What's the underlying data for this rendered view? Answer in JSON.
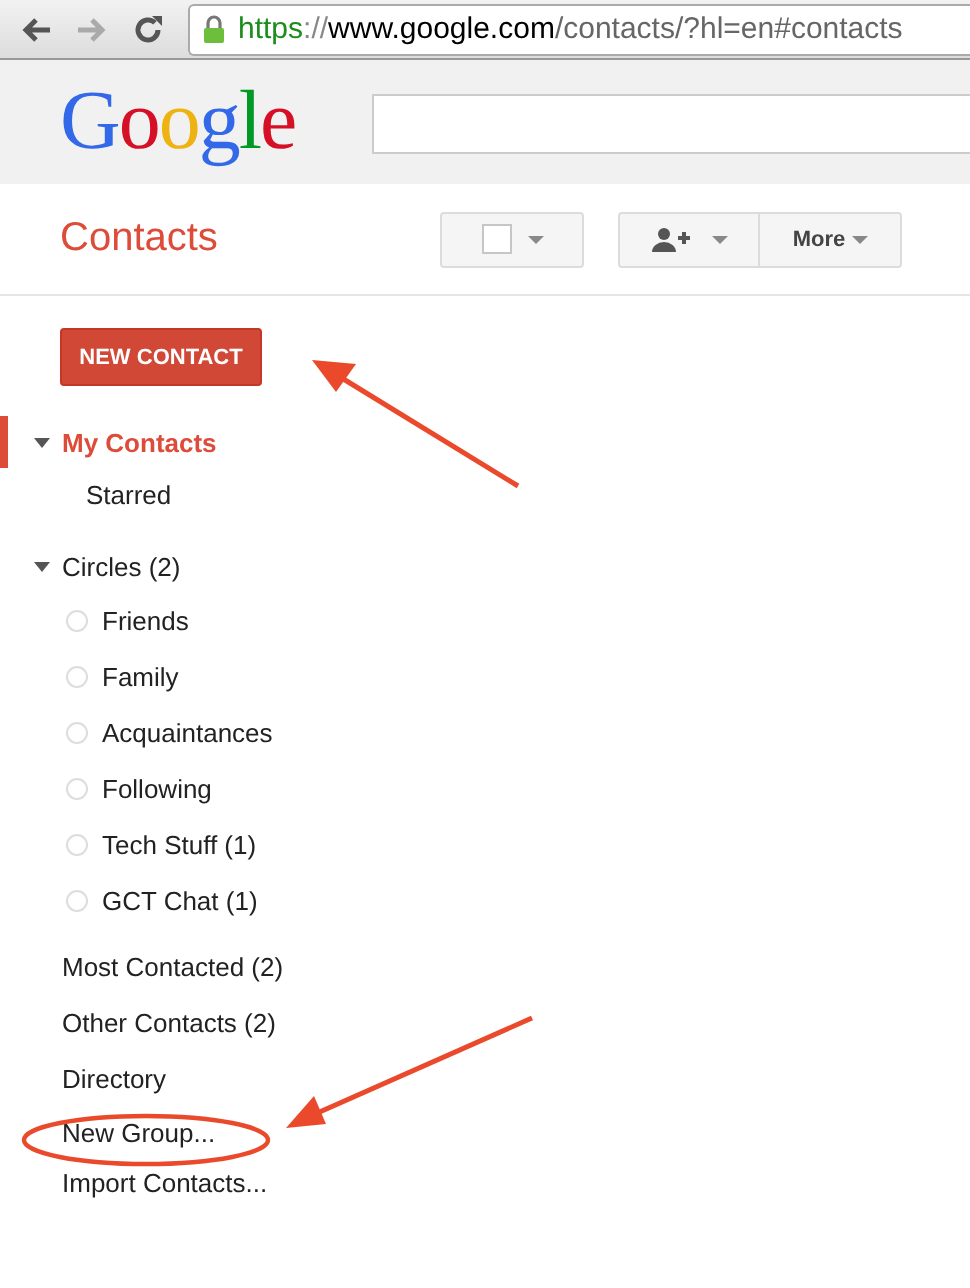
{
  "browser": {
    "url": [
      {
        "kind": "scheme",
        "text": "https"
      },
      {
        "kind": "sep",
        "text": "://"
      },
      {
        "kind": "host",
        "text": "www.google.com"
      },
      {
        "kind": "path",
        "text": "/contacts/?hl=en#contacts"
      }
    ]
  },
  "header": {
    "logo": "Google"
  },
  "title": "Contacts",
  "toolbar": {
    "select_checked": false,
    "more": "More"
  },
  "new_contact": "NEW CONTACT",
  "sidebar": [
    {
      "kind": "group",
      "label": "My Contacts",
      "selected": true,
      "expanded": true,
      "children": [
        {
          "kind": "item",
          "label": "Starred"
        }
      ]
    },
    {
      "kind": "group",
      "label": "Circles (2)",
      "selected": false,
      "expanded": true,
      "children": [
        {
          "kind": "circle",
          "label": "Friends"
        },
        {
          "kind": "circle",
          "label": "Family"
        },
        {
          "kind": "circle",
          "label": "Acquaintances"
        },
        {
          "kind": "circle",
          "label": "Following"
        },
        {
          "kind": "circle",
          "label": "Tech Stuff (1)"
        },
        {
          "kind": "circle",
          "label": "GCT Chat (1)"
        }
      ]
    },
    {
      "kind": "item",
      "label": "Most Contacted (2)"
    },
    {
      "kind": "item",
      "label": "Other Contacts (2)"
    },
    {
      "kind": "item",
      "label": "Directory"
    },
    {
      "kind": "action",
      "label": "New Group..."
    },
    {
      "kind": "action",
      "label": "Import Contacts..."
    }
  ]
}
